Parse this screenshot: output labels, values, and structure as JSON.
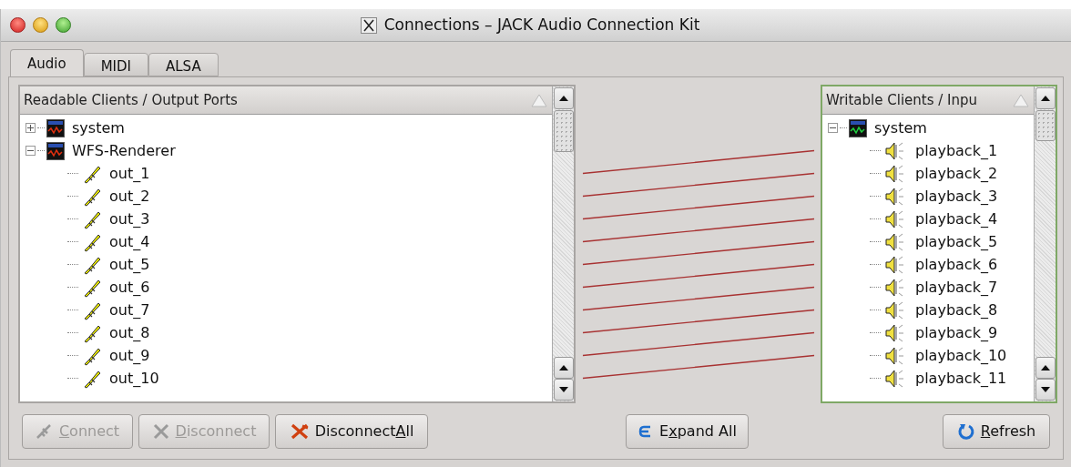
{
  "window": {
    "title": "Connections – JACK Audio Connection Kit"
  },
  "tabs": [
    {
      "label": "Audio",
      "selected": true
    },
    {
      "label": "MIDI",
      "selected": false
    },
    {
      "label": "ALSA",
      "selected": false
    }
  ],
  "readable": {
    "header": "Readable Clients / Output Ports",
    "clients": [
      {
        "name": "system",
        "expanded": false
      },
      {
        "name": "WFS-Renderer",
        "expanded": true,
        "children": [
          {
            "name": "out_1",
            "connected": true
          },
          {
            "name": "out_2",
            "connected": true
          },
          {
            "name": "out_3",
            "connected": true
          },
          {
            "name": "out_4",
            "connected": true
          },
          {
            "name": "out_5",
            "connected": true
          },
          {
            "name": "out_6",
            "connected": true
          },
          {
            "name": "out_7",
            "connected": true
          },
          {
            "name": "out_8",
            "connected": true
          },
          {
            "name": "out_9",
            "connected": true
          },
          {
            "name": "out_10",
            "connected": true
          }
        ]
      }
    ]
  },
  "writable": {
    "header": "Writable Clients / Inpu",
    "focused": true,
    "clients": [
      {
        "name": "system",
        "expanded": true,
        "children": [
          {
            "name": "playback_1"
          },
          {
            "name": "playback_2"
          },
          {
            "name": "playback_3"
          },
          {
            "name": "playback_4"
          },
          {
            "name": "playback_5"
          },
          {
            "name": "playback_6"
          },
          {
            "name": "playback_7"
          },
          {
            "name": "playback_8"
          },
          {
            "name": "playback_9"
          },
          {
            "name": "playback_10"
          },
          {
            "name": "playback_11"
          }
        ]
      }
    ]
  },
  "buttons": [
    {
      "kind": "connect",
      "key": "C",
      "after": "onnect",
      "disabled": true
    },
    {
      "kind": "disconnect",
      "key": "D",
      "after": "isconnect",
      "disabled": true
    },
    {
      "kind": "disconnect_all",
      "before": "Disconnect",
      "key": "A",
      "after": "ll",
      "disabled": false
    },
    {
      "kind": "expand",
      "before": "E",
      "key": "x",
      "after": "pand All",
      "disabled": false
    },
    {
      "kind": "refresh",
      "key": "R",
      "after": "efresh",
      "disabled": false
    }
  ]
}
